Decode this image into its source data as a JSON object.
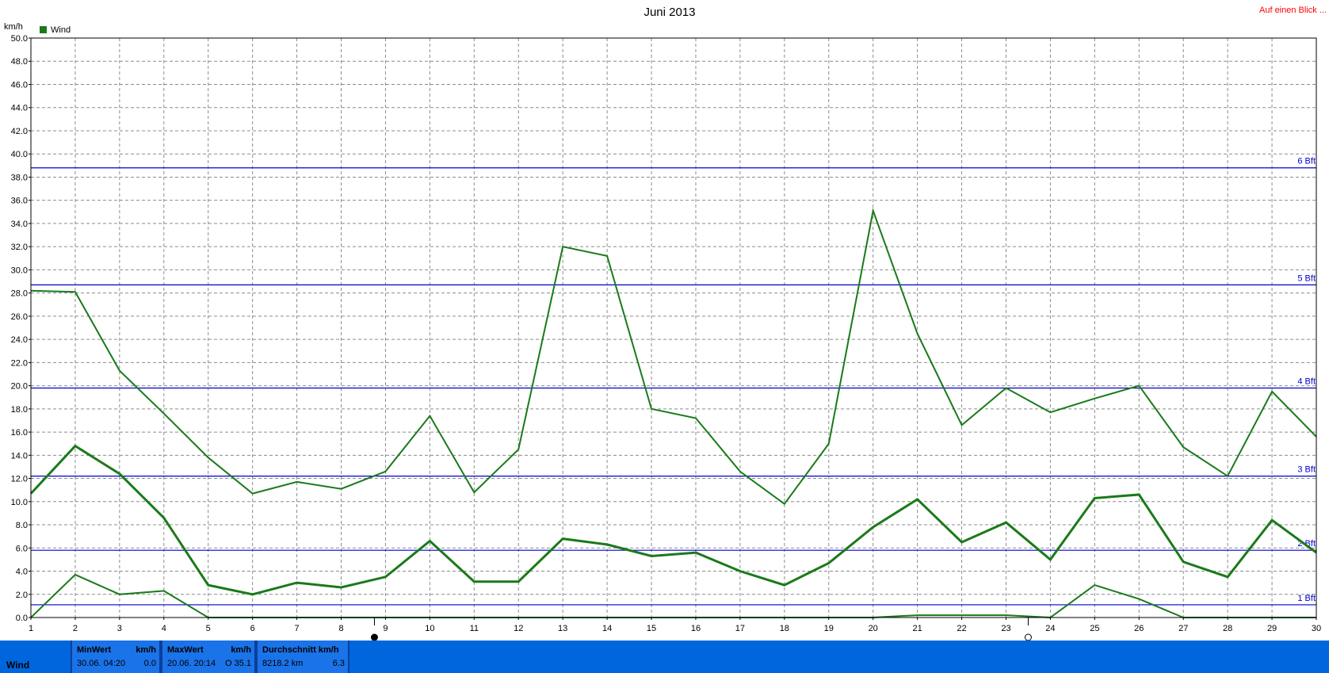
{
  "title": "Juni 2013",
  "link": "Auf einen Blick ...",
  "y_unit": "km/h",
  "legend": {
    "label": "Wind",
    "color": "#1a7a1a"
  },
  "colors": {
    "series": "#1a7a1a",
    "beaufort": "#0000cc",
    "grid": "#8c8c8c"
  },
  "chart_data": {
    "type": "line",
    "title": "Juni 2013",
    "ylabel": "km/h",
    "ylim": [
      0,
      50
    ],
    "y_ticks": [
      "0.0",
      "2.0",
      "4.0",
      "6.0",
      "8.0",
      "10.0",
      "12.0",
      "14.0",
      "16.0",
      "18.0",
      "20.0",
      "22.0",
      "24.0",
      "26.0",
      "28.0",
      "30.0",
      "32.0",
      "34.0",
      "36.0",
      "38.0",
      "40.0",
      "42.0",
      "44.0",
      "46.0",
      "48.0",
      "50.0"
    ],
    "x": [
      1,
      2,
      3,
      4,
      5,
      6,
      7,
      8,
      9,
      10,
      11,
      12,
      13,
      14,
      15,
      16,
      17,
      18,
      19,
      20,
      21,
      22,
      23,
      24,
      25,
      26,
      27,
      28,
      29,
      30
    ],
    "xlim": [
      1,
      30
    ],
    "grid": true,
    "legend_position": "top-left",
    "series": [
      {
        "name": "Wind",
        "role": "max",
        "width": 2,
        "values": [
          28.2,
          28.1,
          21.3,
          17.6,
          13.8,
          10.7,
          11.7,
          11.1,
          12.6,
          17.4,
          10.8,
          14.5,
          32.0,
          31.2,
          18.0,
          17.2,
          12.6,
          9.8,
          15.0,
          35.1,
          24.5,
          16.6,
          19.8,
          17.7,
          18.9,
          20.0,
          14.7,
          12.2,
          19.5,
          15.6
        ]
      },
      {
        "name": "Wind",
        "role": "avg",
        "width": 3,
        "values": [
          10.7,
          14.8,
          12.4,
          8.6,
          2.8,
          2.0,
          3.0,
          2.6,
          3.5,
          6.6,
          3.1,
          3.1,
          6.8,
          6.3,
          5.3,
          5.6,
          4.0,
          2.8,
          4.7,
          7.8,
          10.2,
          6.5,
          8.2,
          5.0,
          10.3,
          10.6,
          4.8,
          3.5,
          8.4,
          5.6
        ]
      },
      {
        "name": "Wind",
        "role": "min",
        "width": 2,
        "values": [
          0.0,
          3.7,
          2.0,
          2.3,
          0.0,
          0.0,
          0.0,
          0.0,
          0.0,
          0.0,
          0.0,
          0.0,
          0.0,
          0.0,
          0.0,
          0.0,
          0.0,
          0.0,
          0.0,
          0.0,
          0.2,
          0.2,
          0.2,
          0.0,
          2.8,
          1.6,
          0.0,
          0.0,
          0.0,
          0.0
        ]
      }
    ],
    "beaufort_lines": [
      {
        "label": "1 Bft",
        "value": 1.1
      },
      {
        "label": "2 Bft",
        "value": 5.8
      },
      {
        "label": "3 Bft",
        "value": 12.2
      },
      {
        "label": "4 Bft",
        "value": 19.8
      },
      {
        "label": "5 Bft",
        "value": 28.7
      },
      {
        "label": "6 Bft",
        "value": 38.8
      }
    ],
    "moon_markers": [
      {
        "day": 8.75,
        "phase": "new-moon"
      },
      {
        "day": 23.5,
        "phase": "full-moon"
      }
    ]
  },
  "status": {
    "series_name": "Wind",
    "min": {
      "head": "MinWert",
      "unit": "km/h",
      "when": "30.06.  04:20",
      "value": "0.0"
    },
    "max": {
      "head": "MaxWert",
      "unit": "km/h",
      "when": "20.06.  20:14",
      "value": "O 35.1"
    },
    "avg": {
      "head": "Durchschnitt km/h",
      "when": "8218.2 km",
      "value": "6.3"
    }
  }
}
